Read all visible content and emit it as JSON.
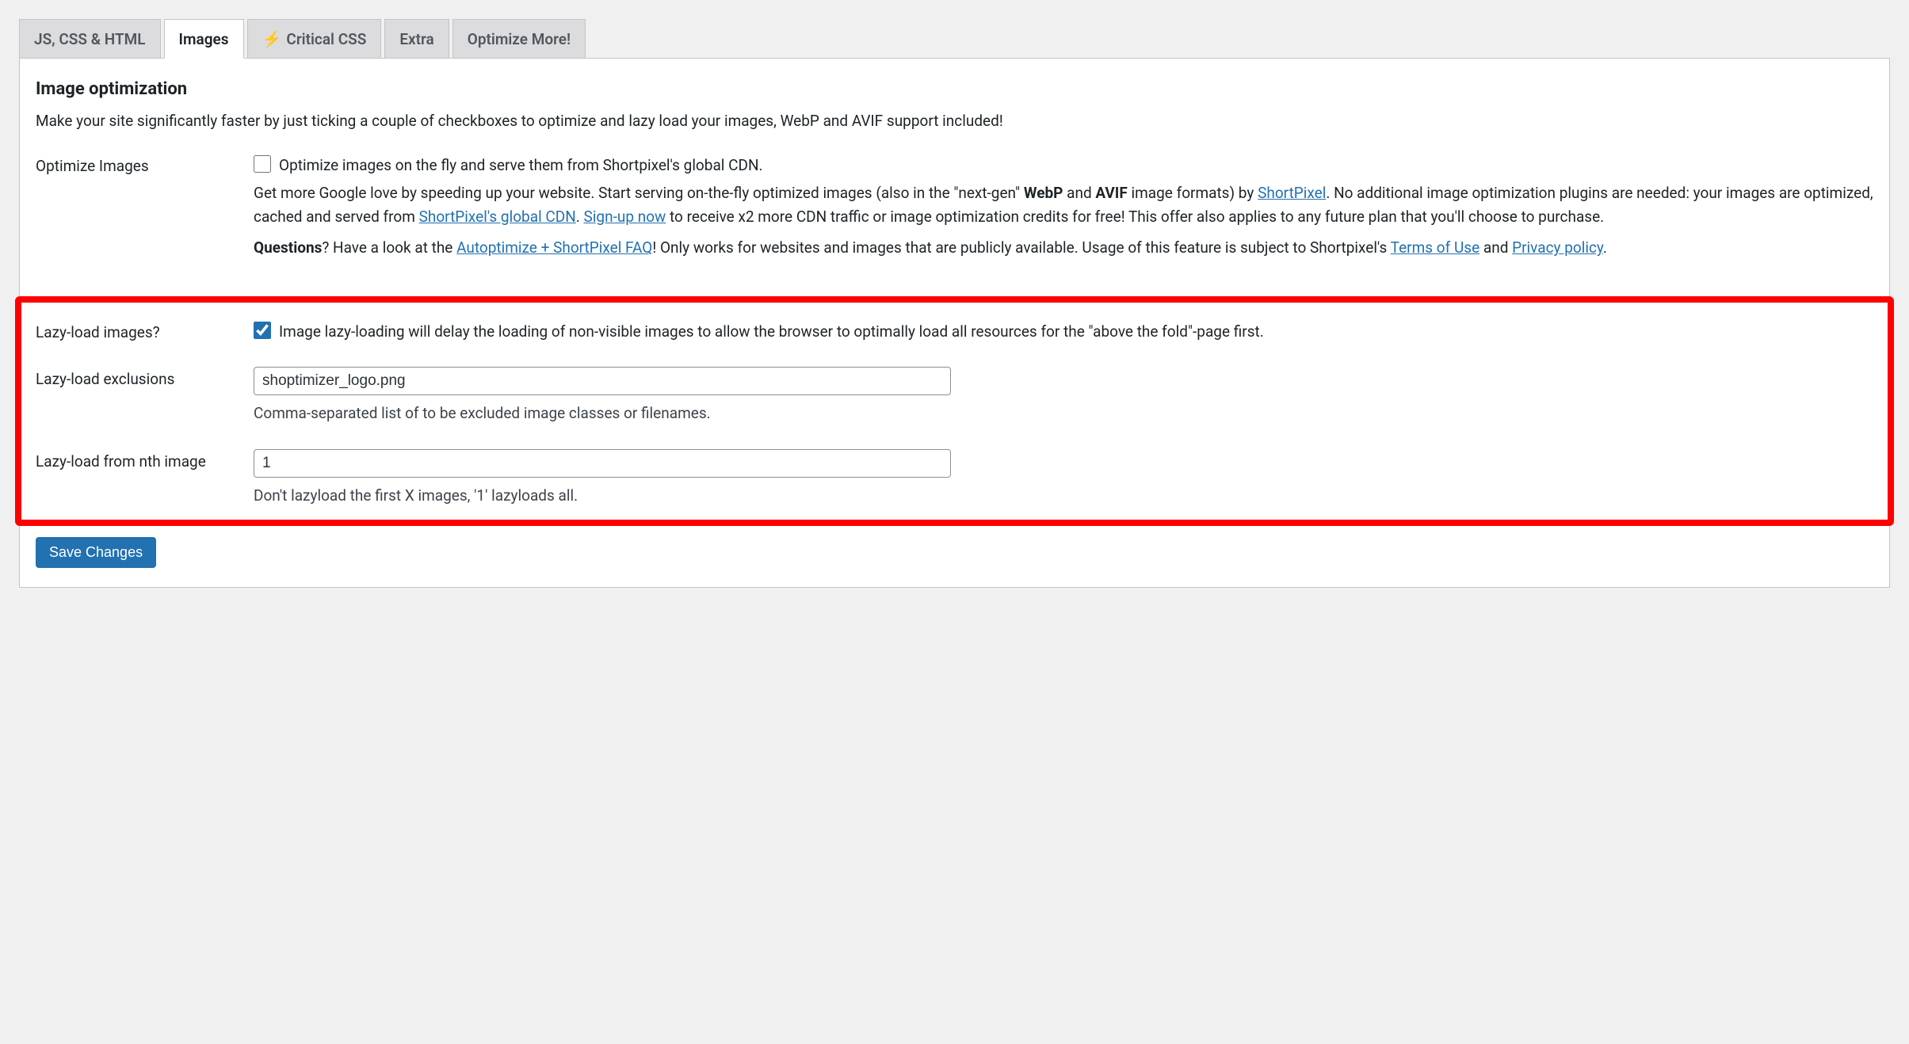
{
  "tabs": [
    {
      "label": "JS, CSS & HTML",
      "active": false
    },
    {
      "label": "Images",
      "active": true
    },
    {
      "label": "Critical CSS",
      "active": false,
      "icon": "bolt"
    },
    {
      "label": "Extra",
      "active": false
    },
    {
      "label": "Optimize More!",
      "active": false
    }
  ],
  "section": {
    "title": "Image optimization",
    "description": "Make your site significantly faster by just ticking a couple of checkboxes to optimize and lazy load your images, WebP and AVIF support included!"
  },
  "rows": {
    "optimize_images": {
      "label": "Optimize Images",
      "checkbox_label": "Optimize images on the fly and serve them from Shortpixel's global CDN.",
      "checked": false,
      "desc_part1": "Get more Google love by speeding up your website. Start serving on-the-fly optimized images (also in the \"next-gen\" ",
      "desc_boldA": "WebP",
      "desc_mid": " and ",
      "desc_boldB": "AVIF",
      "desc_part2": " image formats) by ",
      "link_shortpixel": "ShortPixel",
      "desc_part3": ". No additional image optimization plugins are needed: your images are optimized, cached and served from ",
      "link_cdn": "ShortPixel's global CDN",
      "desc_part4": ". ",
      "link_signup": "Sign-up now",
      "desc_part5": " to receive x2 more CDN traffic or image optimization credits for free! This offer also applies to any future plan that you'll choose to purchase.",
      "q_bold": "Questions",
      "q_part1": "? Have a look at the ",
      "link_faq": "Autoptimize + ShortPixel FAQ",
      "q_part2": "! Only works for websites and images that are publicly available. Usage of this feature is subject to Shortpixel's ",
      "link_tou": "Terms of Use",
      "q_and": " and ",
      "link_privacy": "Privacy policy",
      "q_end": "."
    },
    "lazy_load": {
      "label": "Lazy-load images?",
      "checkbox_label": "Image lazy-loading will delay the loading of non-visible images to allow the browser to optimally load all resources for the \"above the fold\"-page first.",
      "checked": true
    },
    "lazy_exclusions": {
      "label": "Lazy-load exclusions",
      "value": "shoptimizer_logo.png",
      "help": "Comma-separated list of to be excluded image classes or filenames."
    },
    "lazy_nth": {
      "label": "Lazy-load from nth image",
      "value": "1",
      "help": "Don't lazyload the first X images, '1' lazyloads all."
    }
  },
  "submit": {
    "label": "Save Changes"
  }
}
